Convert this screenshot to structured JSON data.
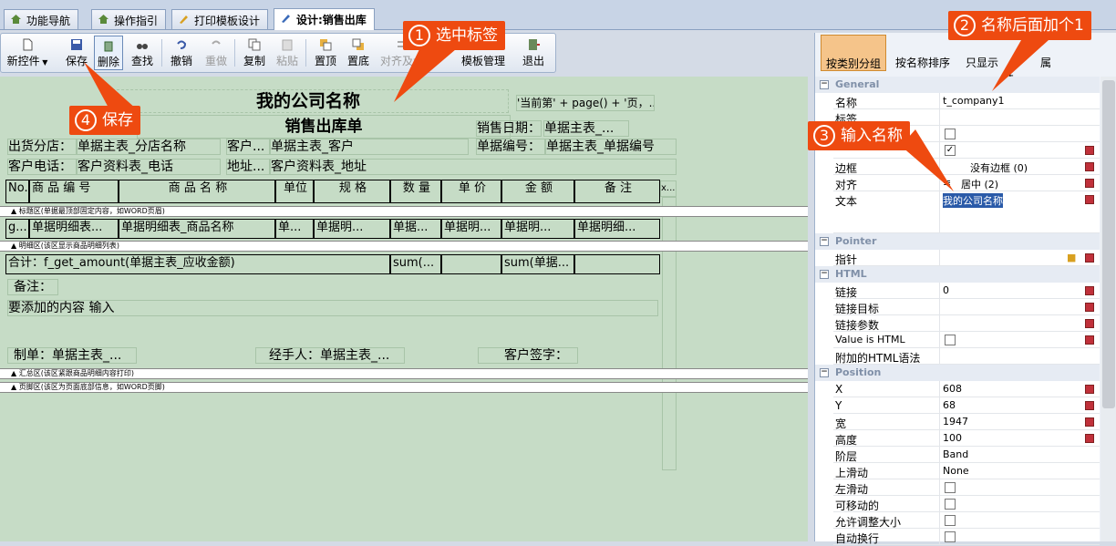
{
  "tabs": [
    "功能导航",
    "操作指引",
    "打印模板设计",
    "设计:销售出库"
  ],
  "toolbar": {
    "new": "新控件",
    "save": "保存",
    "delete": "删除",
    "find": "查找",
    "undo": "撤销",
    "redo": "重做",
    "copy": "复制",
    "paste": "粘贴",
    "top": "置顶",
    "bottom": "置底",
    "align": "对齐及大",
    "tpl": "模板管理",
    "exit": "退出"
  },
  "canvas": {
    "company": "我的公司名称",
    "title": "销售出库单",
    "page_expr": "'当前第' + page() + '页，...",
    "date_label": "销售日期：",
    "date_val": "单据主表_...",
    "branch_label": "出货分店：",
    "branch_val": "单据主表_分店名称",
    "cust_label": "客户...",
    "cust_val": "单据主表_客户",
    "no_label": "单据编号：",
    "no_val": "单据主表_单据编号",
    "phone_label": "客户电话：",
    "phone_val": "客户资料表_电话",
    "addr_label": "地址...",
    "addr_val": "客户资料表_地址",
    "headers": [
      "No.",
      "商 品 编 号",
      "商 品 名 称",
      "单位",
      "规 格",
      "数 量",
      "单 价",
      "金 额",
      "备 注",
      "x..."
    ],
    "band_header": "标题区(单据最顶部固定内容，如WORD页眉)",
    "detail": [
      "g...",
      "单据明细表...",
      "单据明细表_商品名称",
      "单...",
      "单据明...",
      "单据...",
      "单据明...",
      "单据明...",
      "单据明细..."
    ],
    "band_detail": "明细区(该区显示商品明细列表)",
    "total_label": "合计：f_get_amount(单据主表_应收金额)",
    "total_qty": "sum(...",
    "total_amt": "sum(单据...",
    "remark_label": "备注：",
    "extra": "要添加的内容 输入",
    "maker": "制单：单据主表_...",
    "handler": "经手人：单据主表_...",
    "sign": "客户签字：",
    "band_sum": "汇总区(该区紧跟商品明细内容打印)",
    "band_footer": "页脚区(该区为页面底部信息，如WORD页脚)"
  },
  "panel": {
    "btn_group": "按类别分组",
    "btn_sort": "按名称排序",
    "btn_only": "只显示",
    "btn_attr": "属性",
    "general": "General",
    "name_k": "名称",
    "name_v": "t_company1",
    "tag_k": "标签",
    "border_k": "边框",
    "border_v": "没有边框 (0)",
    "align_k": "对齐",
    "align_v": "居中 (2)",
    "text_k": "文本",
    "text_v": "我的公司名称",
    "pointer": "Pointer",
    "ptr_k": "指针",
    "html": "HTML",
    "link_k": "链接",
    "link_v": "0",
    "target_k": "链接目标",
    "param_k": "链接参数",
    "ishtml_k": "Value is HTML",
    "htmlsyn_k": "附加的HTML语法",
    "position": "Position",
    "x_k": "X",
    "x_v": "608",
    "y_k": "Y",
    "y_v": "68",
    "w_k": "宽",
    "w_v": "1947",
    "h_k": "高度",
    "h_v": "100",
    "layer_k": "阶层",
    "layer_v": "Band",
    "slide_k": "上滑动",
    "slide_v": "None",
    "lslide_k": "左滑动",
    "move_k": "可移动的",
    "resize_k": "允许调整大小",
    "wrap_k": "自动换行"
  },
  "callouts": {
    "c1": "选中标签",
    "n1": "1",
    "c2": "名称后面加个1",
    "n2": "2",
    "c3": "输入名称",
    "n3": "3",
    "c4": "保存",
    "n4": "4"
  },
  "colors": {
    "callout": "#ee4a10",
    "canvas": "#c6dcc6",
    "selected_tab": "#f5c48a"
  }
}
